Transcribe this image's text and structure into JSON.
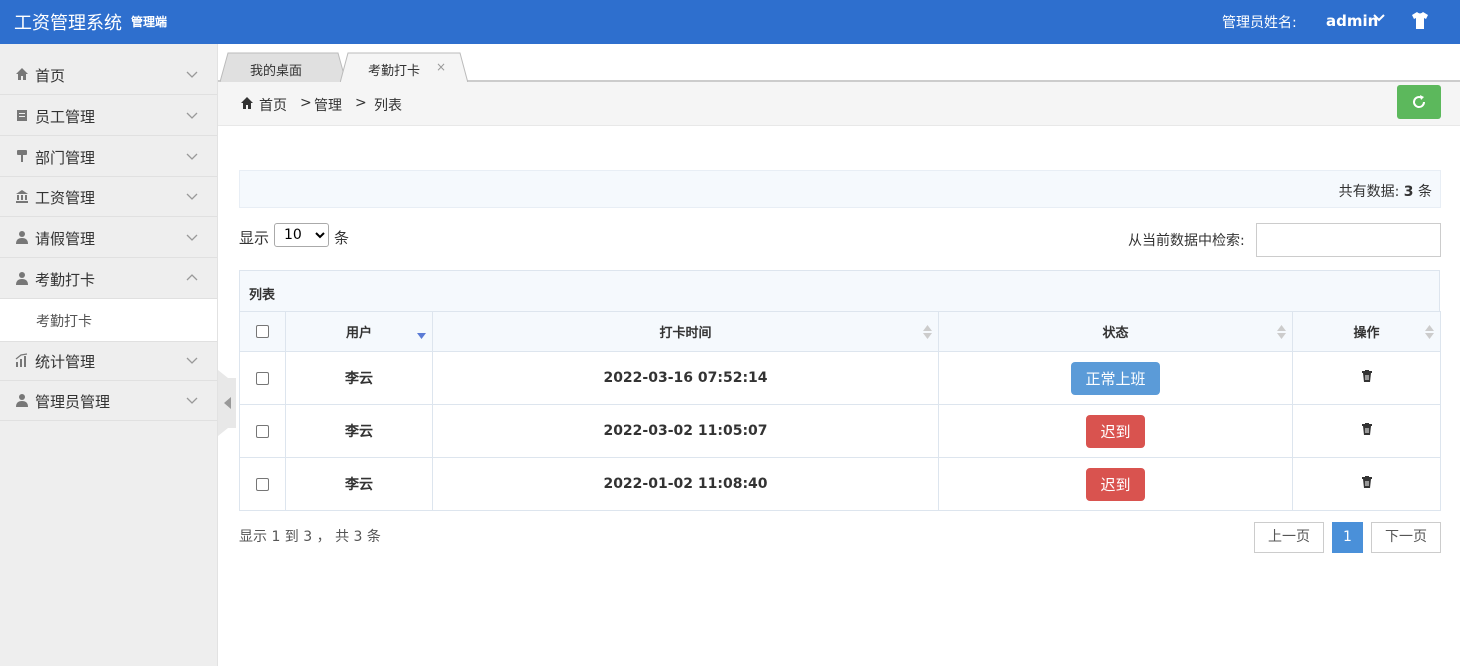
{
  "header": {
    "title": "工资管理系统",
    "subtitle": "管理端",
    "admin_label": "管理员姓名:",
    "admin_name": "admin"
  },
  "sidebar": {
    "items": [
      {
        "label": "首页",
        "icon": "home-icon"
      },
      {
        "label": "员工管理",
        "icon": "clipboard-icon"
      },
      {
        "label": "部门管理",
        "icon": "key-icon"
      },
      {
        "label": "工资管理",
        "icon": "bank-icon"
      },
      {
        "label": "请假管理",
        "icon": "user-icon"
      },
      {
        "label": "考勤打卡",
        "icon": "user-icon",
        "expanded": true
      },
      {
        "label": "统计管理",
        "icon": "chart-icon"
      },
      {
        "label": "管理员管理",
        "icon": "user-icon"
      }
    ],
    "submenu_label": "考勤打卡"
  },
  "tabs": [
    {
      "label": "我的桌面"
    },
    {
      "label": "考勤打卡",
      "close": "×",
      "active": true
    }
  ],
  "breadcrumb": [
    "首页",
    "管理",
    "列表"
  ],
  "breadcrumb_sep": ">",
  "summary": {
    "prefix": "共有数据:",
    "count": "3",
    "suffix": "条"
  },
  "length": {
    "show": "显示",
    "value": "10",
    "unit": "条",
    "options": [
      "10"
    ]
  },
  "search": {
    "label": "从当前数据中检索:",
    "value": ""
  },
  "panel": {
    "title": "列表"
  },
  "table": {
    "headers": [
      "用户",
      "打卡时间",
      "状态",
      "操作"
    ],
    "rows": [
      {
        "user": "李云",
        "time": "2022-03-16 07:52:14",
        "status": "正常上班",
        "status_color": "#5b9bd8"
      },
      {
        "user": "李云",
        "time": "2022-03-02 11:05:07",
        "status": "迟到",
        "status_color": "#d9534f"
      },
      {
        "user": "李云",
        "time": "2022-01-02 11:08:40",
        "status": "迟到",
        "status_color": "#d9534f"
      }
    ]
  },
  "info": "显示 1 到 3 ， 共 3 条",
  "pagination": {
    "prev": "上一页",
    "current": "1",
    "next": "下一页"
  },
  "colors": {
    "header": "#2e6fce",
    "refresh": "#5cb85c",
    "page_active": "#4a90d9"
  }
}
